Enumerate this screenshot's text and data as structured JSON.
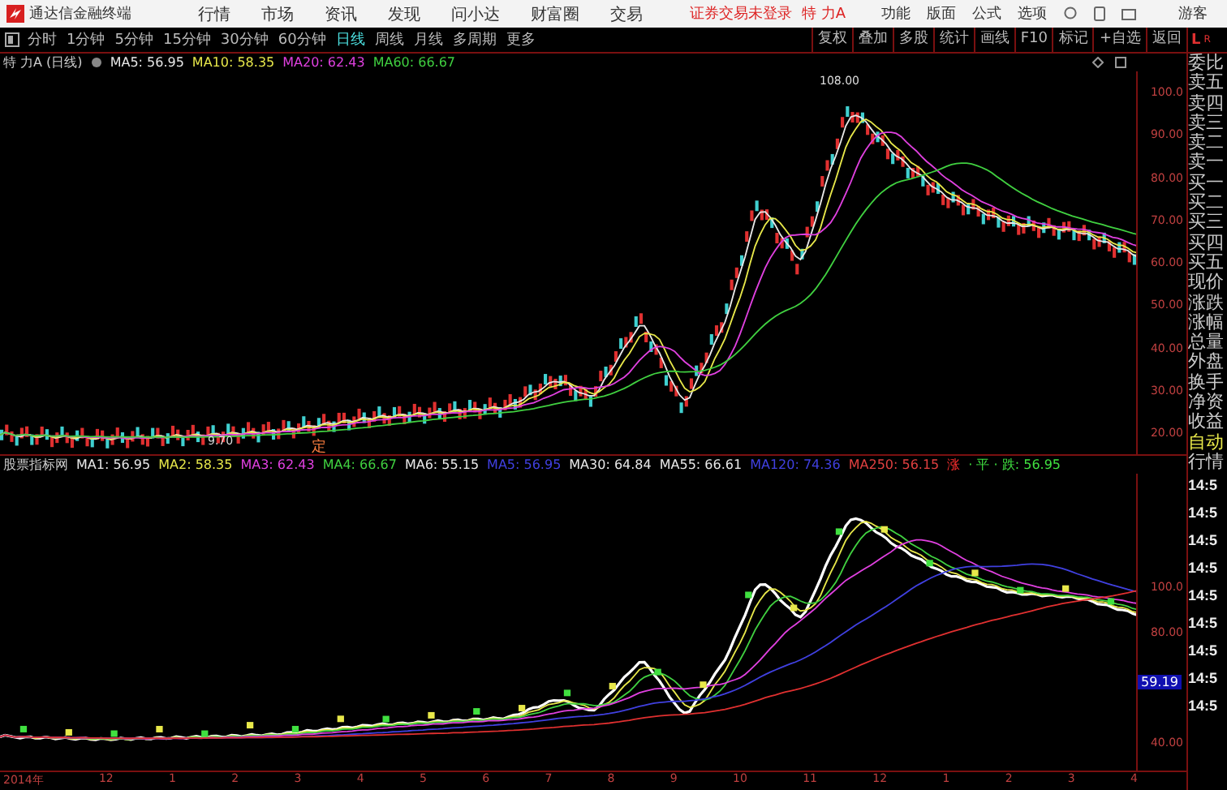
{
  "menubar": {
    "app_title": "通达信金融终端",
    "menus": [
      "行情",
      "市场",
      "资讯",
      "发现",
      "问小达",
      "财富圈",
      "交易"
    ],
    "login_notice": "证券交易未登录",
    "stock_name": "特 力A",
    "right_menus": [
      "功能",
      "版面",
      "公式",
      "选项"
    ],
    "user": "游客"
  },
  "toolbar": {
    "periods": [
      {
        "label": "分时",
        "selected": false
      },
      {
        "label": "1分钟",
        "selected": false
      },
      {
        "label": "5分钟",
        "selected": false
      },
      {
        "label": "15分钟",
        "selected": false
      },
      {
        "label": "30分钟",
        "selected": false
      },
      {
        "label": "60分钟",
        "selected": false
      },
      {
        "label": "日线",
        "selected": true
      },
      {
        "label": "周线",
        "selected": false
      },
      {
        "label": "月线",
        "selected": false
      },
      {
        "label": "多周期",
        "selected": false
      },
      {
        "label": "更多",
        "selected": false
      }
    ],
    "actions": [
      "复权",
      "叠加",
      "多股",
      "统计",
      "画线",
      "F10",
      "标记",
      "+自选",
      "返回"
    ]
  },
  "price_chart": {
    "title": "特 力A (日线)",
    "legend": [
      {
        "text": "MA5: 56.95",
        "color": "#e8e8e8"
      },
      {
        "text": "MA10: 58.35",
        "color": "#e8e84a"
      },
      {
        "text": "MA20: 62.43",
        "color": "#e040e0"
      },
      {
        "text": "MA60: 66.67",
        "color": "#40d040"
      }
    ],
    "high_label": "108.00",
    "low_label": "9.70",
    "marker": "定",
    "axis_labels": [
      "100.0",
      "90.00",
      "80.00",
      "70.00",
      "60.00",
      "50.00",
      "40.00",
      "30.00",
      "20.00"
    ]
  },
  "indicator_chart": {
    "title": "股票指标网",
    "legend": [
      {
        "text": "MA1: 56.95",
        "color": "#e8e8e8"
      },
      {
        "text": "MA2: 58.35",
        "color": "#e8e84a"
      },
      {
        "text": "MA3: 62.43",
        "color": "#e040e0"
      },
      {
        "text": "MA4: 66.67",
        "color": "#40d040"
      },
      {
        "text": "MA6: 55.15",
        "color": "#e8e8e8"
      },
      {
        "text": "MA5: 56.95",
        "color": "#4040e0"
      },
      {
        "text": "MA30: 64.84",
        "color": "#e8e8e8"
      },
      {
        "text": "MA55: 66.61",
        "color": "#e8e8e8"
      },
      {
        "text": "MA120: 74.36",
        "color": "#4040e0"
      },
      {
        "text": "MA250: 56.15",
        "color": "#e04040"
      },
      {
        "text": "涨",
        "color": "#ff3030"
      },
      {
        "text": "· 平 · 跌: 56.95",
        "color": "#40e040"
      }
    ],
    "axis_labels": [
      "100.0",
      "80.00",
      "40.00"
    ],
    "current_value": "59.19"
  },
  "x_axis": [
    "2014年",
    "12",
    "1",
    "2",
    "3",
    "4",
    "5",
    "6",
    "7",
    "8",
    "9",
    "10",
    "11",
    "12",
    "1",
    "2",
    "3",
    "4"
  ],
  "side_panel": {
    "header_left": "L",
    "header_right": "R",
    "quote_labels": [
      "委比",
      "卖五",
      "卖四",
      "卖三",
      "卖二",
      "卖一",
      "买一",
      "买二",
      "买三",
      "买四",
      "买五",
      "现价",
      "涨跌",
      "涨幅",
      "总量",
      "外盘",
      "换手",
      "净资",
      "收益"
    ],
    "auto_label": "自动",
    "trades_label": "行情",
    "times": [
      "14:5",
      "14:5",
      "14:5",
      "14:5",
      "14:5",
      "14:5",
      "14:5",
      "14:5",
      "14:5"
    ]
  }
}
